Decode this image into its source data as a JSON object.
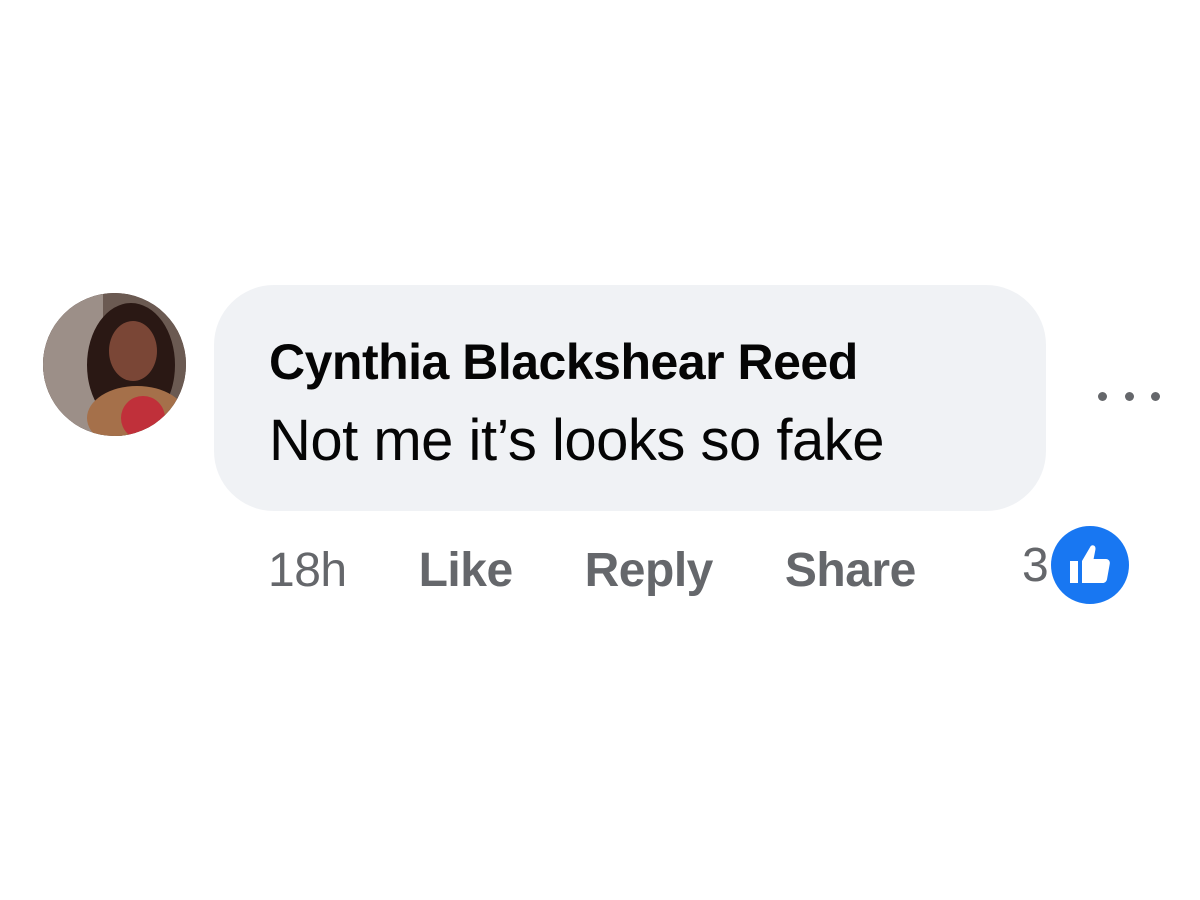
{
  "comment": {
    "author": "Cynthia Blackshear Reed",
    "text": "Not me it’s looks so fake",
    "avatar_icon": "profile-photo",
    "more_icon": "more-options-icon"
  },
  "actions": {
    "time": "18h",
    "like_label": "Like",
    "reply_label": "Reply",
    "share_label": "Share"
  },
  "reactions": {
    "count": "3",
    "icon": "thumbs-up-icon"
  },
  "colors": {
    "bubble_bg": "#f0f2f5",
    "text": "#050505",
    "muted": "#65676b",
    "like_blue": "#1877f2"
  }
}
